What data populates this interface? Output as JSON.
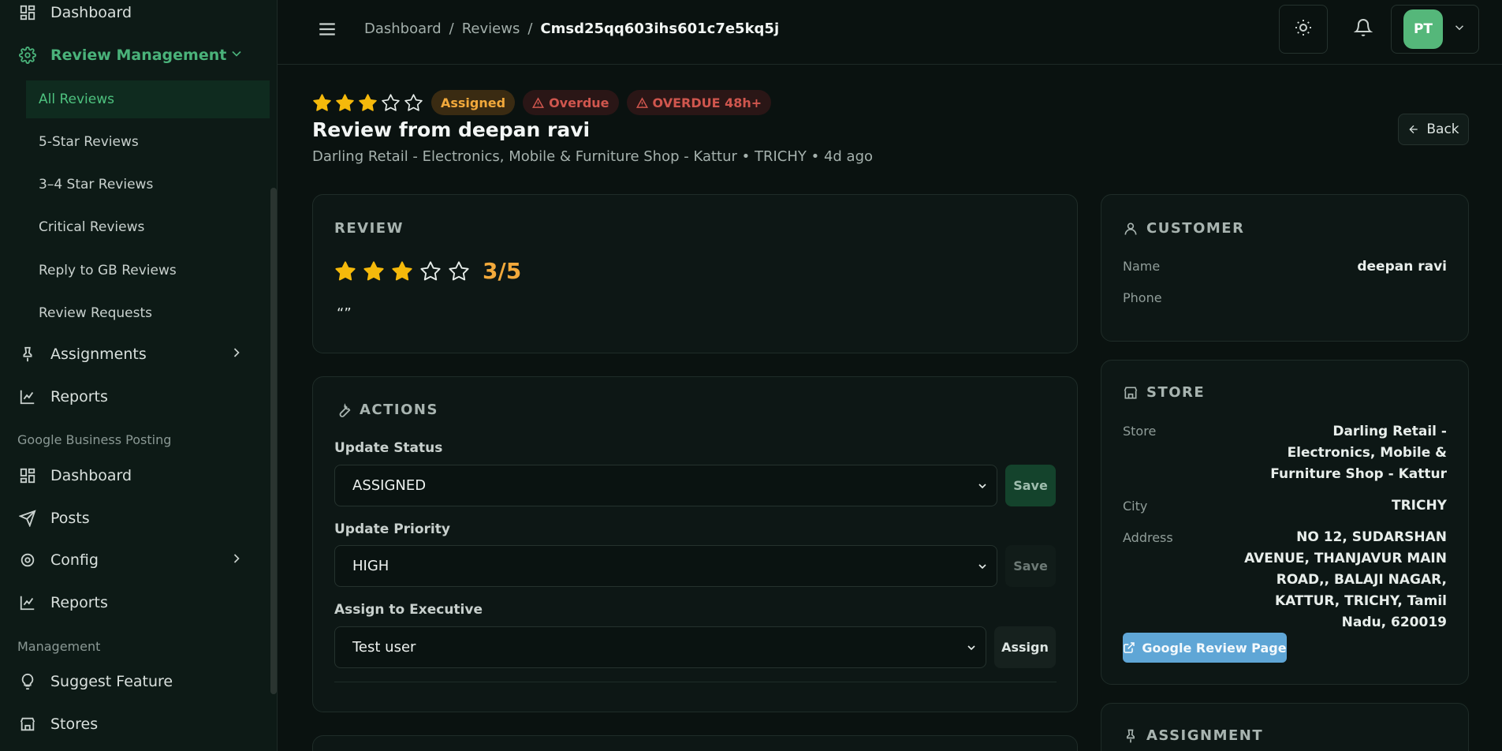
{
  "sidebar": {
    "items": [
      {
        "label": "Dashboard"
      },
      {
        "label": "Review Management"
      },
      {
        "label": "Assignments"
      },
      {
        "label": "Reports"
      }
    ],
    "review_sub": [
      {
        "label": "All Reviews"
      },
      {
        "label": "5-Star Reviews"
      },
      {
        "label": "3–4 Star Reviews"
      },
      {
        "label": "Critical Reviews"
      },
      {
        "label": "Reply to GB Reviews"
      },
      {
        "label": "Review Requests"
      }
    ],
    "group_google": "Google Business Posting",
    "google_items": [
      {
        "label": "Dashboard"
      },
      {
        "label": "Posts"
      },
      {
        "label": "Config"
      },
      {
        "label": "Reports"
      }
    ],
    "group_management": "Management",
    "management_items": [
      {
        "label": "Suggest Feature"
      },
      {
        "label": "Stores"
      }
    ]
  },
  "topbar": {
    "breadcrumb": [
      "Dashboard",
      "/",
      "Reviews",
      "/",
      "Cmsd25qq603ihs601c7e5kq5j"
    ],
    "avatar_initials": "PT"
  },
  "header": {
    "rating": 3,
    "badges": {
      "status": "Assigned",
      "overdue": "Overdue",
      "overdue48": "OVERDUE 48h+"
    },
    "title": "Review from deepan ravi",
    "subtitle": "Darling Retail - Electronics, Mobile & Furniture Shop - Kattur • TRICHY • 4d ago",
    "back": "Back"
  },
  "review_card": {
    "heading": "REVIEW",
    "rating": 3,
    "score": "3/5",
    "text": "“”"
  },
  "actions_card": {
    "heading": "ACTIONS",
    "status_label": "Update Status",
    "status_value": "ASSIGNED",
    "status_save": "Save",
    "priority_label": "Update Priority",
    "priority_value": "HIGH",
    "priority_save": "Save",
    "assign_label": "Assign to Executive",
    "assign_value": "Test user",
    "assign_button": "Assign"
  },
  "customer_card": {
    "heading": "CUSTOMER",
    "name_label": "Name",
    "name_value": "deepan ravi",
    "phone_label": "Phone"
  },
  "store_card": {
    "heading": "STORE",
    "store_label": "Store",
    "store_value": "Darling Retail - Electronics, Mobile & Furniture Shop - Kattur",
    "city_label": "City",
    "city_value": "TRICHY",
    "address_label": "Address",
    "address_value": "NO 12, SUDARSHAN AVENUE, THANJAVUR MAIN ROAD,, BALAJI NAGAR, KATTUR, TRICHY, Tamil Nadu, 620019",
    "google_button": "Google Review Page"
  },
  "assignment_card": {
    "heading": "ASSIGNMENT"
  },
  "colors": {
    "accent": "#4ab27a",
    "star": "#f5b90b",
    "warning": "#f2a93b",
    "danger": "#d0564e"
  }
}
